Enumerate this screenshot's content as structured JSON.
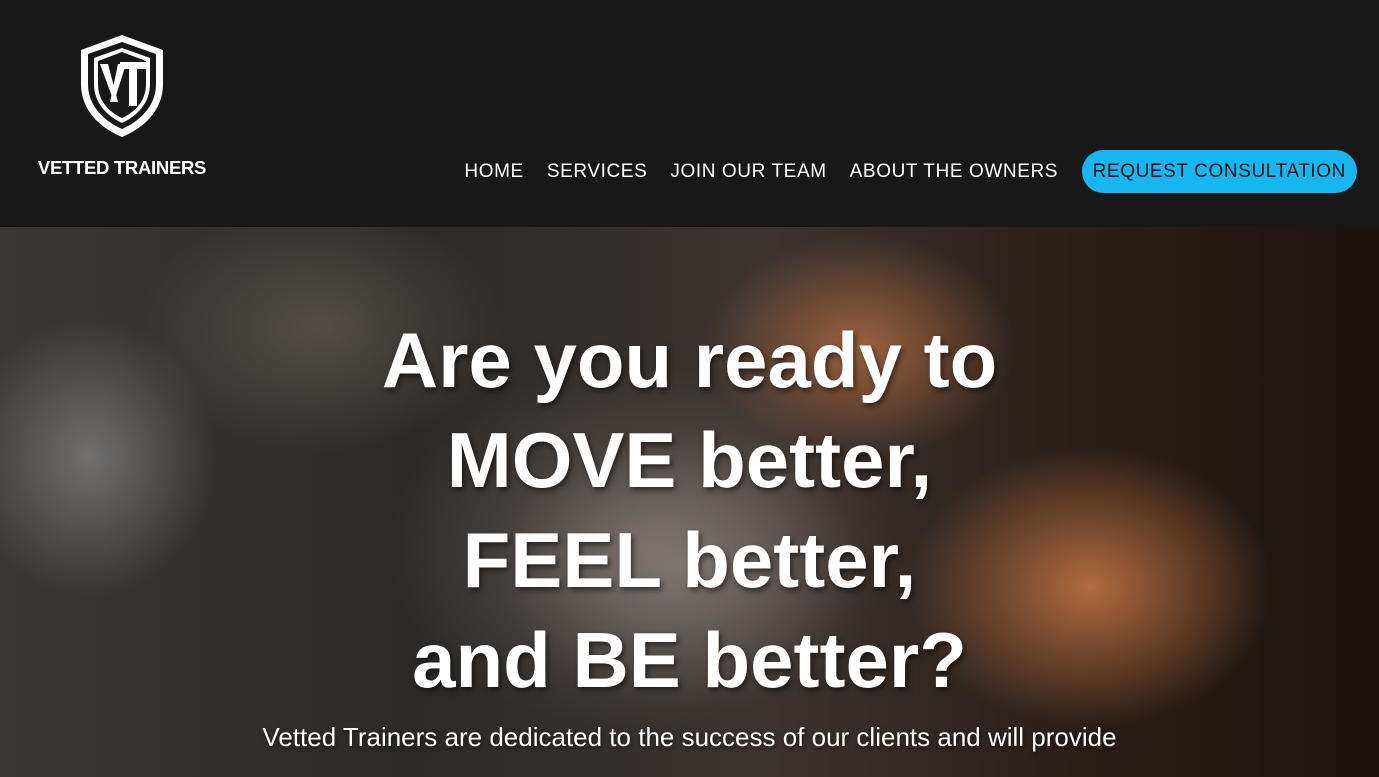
{
  "header": {
    "logo_text": "VETTED TRAINERS",
    "logo_icon": "vt-shield-logo",
    "nav": {
      "items": [
        {
          "label": "HOME"
        },
        {
          "label": "SERVICES"
        },
        {
          "label": "JOIN OUR TEAM"
        },
        {
          "label": "ABOUT THE OWNERS"
        }
      ],
      "cta_label": "REQUEST CONSULTATION"
    }
  },
  "hero": {
    "headline_lines": [
      "Are you ready to",
      "MOVE better,",
      "FEEL better,",
      "and BE better?"
    ],
    "tagline": "Vetted Trainers are dedicated to the success of our clients and will provide"
  },
  "colors": {
    "header_bg": "#181818",
    "cta_bg": "#16b6f0",
    "text": "#ffffff"
  }
}
